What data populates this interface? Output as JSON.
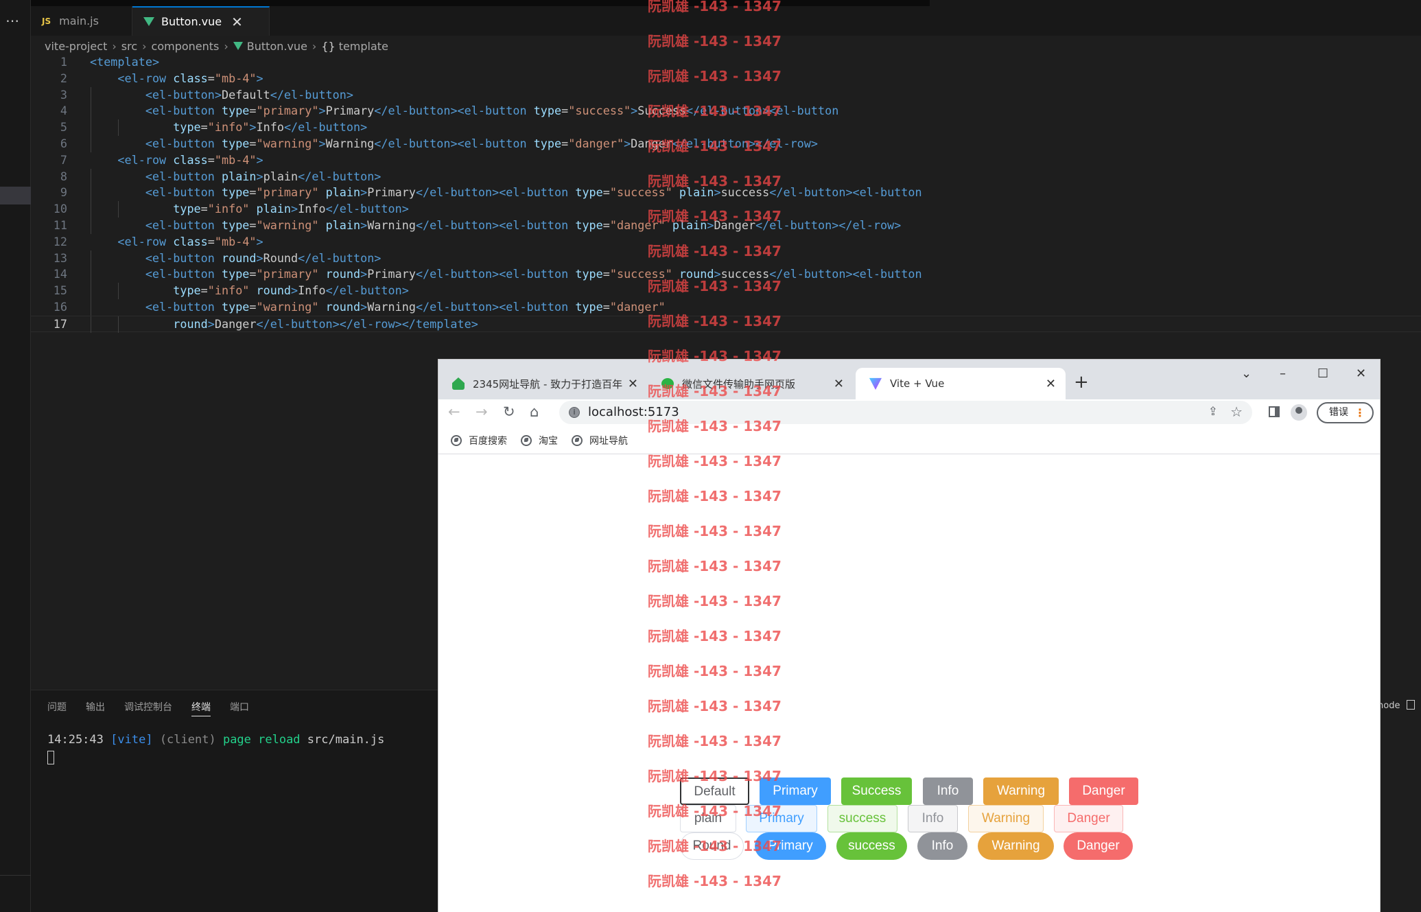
{
  "editor": {
    "tabs": [
      {
        "label": "main.js",
        "icon": "js-file-icon"
      },
      {
        "label": "Button.vue",
        "icon": "vue-file-icon"
      }
    ],
    "breadcrumb": [
      "vite-project",
      "src",
      "components",
      "Button.vue",
      "template"
    ],
    "code_lines": [
      "<template>",
      "    <el-row class=\"mb-4\">",
      "        <el-button>Default</el-button>",
      "        <el-button type=\"primary\">Primary</el-button><el-button type=\"success\">Success</el-button><el-button",
      "            type=\"info\">Info</el-button>",
      "        <el-button type=\"warning\">Warning</el-button><el-button type=\"danger\">Danger</el-button></el-row>",
      "    <el-row class=\"mb-4\">",
      "        <el-button plain>plain</el-button>",
      "        <el-button type=\"primary\" plain>Primary</el-button><el-button type=\"success\" plain>success</el-button><el-button",
      "            type=\"info\" plain>Info</el-button>",
      "        <el-button type=\"warning\" plain>Warning</el-button><el-button type=\"danger\" plain>Danger</el-button></el-row>",
      "    <el-row class=\"mb-4\">",
      "        <el-button round>Round</el-button>",
      "        <el-button type=\"primary\" round>Primary</el-button><el-button type=\"success\" round>success</el-button><el-button",
      "            type=\"info\" round>Info</el-button>",
      "        <el-button type=\"warning\" round>Warning</el-button><el-button type=\"danger\"",
      "            round>Danger</el-button></el-row></template>"
    ]
  },
  "panel": {
    "tabs": [
      "问题",
      "输出",
      "调试控制台",
      "终端",
      "端口"
    ],
    "active_tab": "终端",
    "terminal": {
      "time": "14:25:43",
      "tag": "[vite]",
      "client": "(client)",
      "action": "page reload",
      "file": "src/main.js"
    },
    "right_label": "node"
  },
  "browser": {
    "tabs": [
      {
        "title": "2345网址导航 - 致力于打造百年",
        "icon": "house-favicon-icon"
      },
      {
        "title": "微信文件传输助手网页版",
        "icon": "wechat-favicon-icon"
      },
      {
        "title": "Vite + Vue",
        "icon": "vite-favicon-icon"
      }
    ],
    "url": "localhost:5173",
    "error_button": "错误",
    "bookmarks": [
      "百度搜索",
      "淘宝",
      "网址导航"
    ]
  },
  "buttons": {
    "row1": [
      "Default",
      "Primary",
      "Success",
      "Info",
      "Warning",
      "Danger"
    ],
    "row2": [
      "plain",
      "Primary",
      "success",
      "Info",
      "Warning",
      "Danger"
    ],
    "row3": [
      "Round",
      "Primary",
      "success",
      "Info",
      "Warning",
      "Danger"
    ]
  },
  "watermark": "阮凯雄 -143 - 1347",
  "colors": {
    "primary": "#409eff",
    "success": "#67c23a",
    "info": "#909399",
    "warning": "#e6a23c",
    "danger": "#f56c6c",
    "watermark": "#ec4646"
  }
}
